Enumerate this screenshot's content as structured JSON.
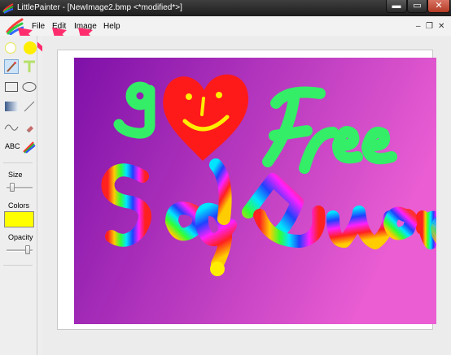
{
  "window": {
    "title": "LittlePainter - [NewImage2.bmp  <*modified*>]",
    "controls": {
      "minimize": "▬",
      "maximize": "▭",
      "close": "✕"
    }
  },
  "menu": {
    "items": [
      "File",
      "Edit",
      "Image",
      "Help"
    ],
    "mdi_controls": {
      "minimize": "–",
      "restore": "❐",
      "close": "✕"
    }
  },
  "toolbox": {
    "tool_text_label": "ABC",
    "size_label": "Size",
    "size_level": 0.15,
    "colors_label": "Colors",
    "selected_color": "#ffff00",
    "opacity_label": "Opacity",
    "opacity_level": 0.9
  },
  "annotation_color": "#ff2d6e",
  "canvas_colors": {
    "background_start": "#8a12b8",
    "background_end": "#ff66e6",
    "green": "#33ee66",
    "heart": "#ff1a1a",
    "face": "#ffee00"
  }
}
